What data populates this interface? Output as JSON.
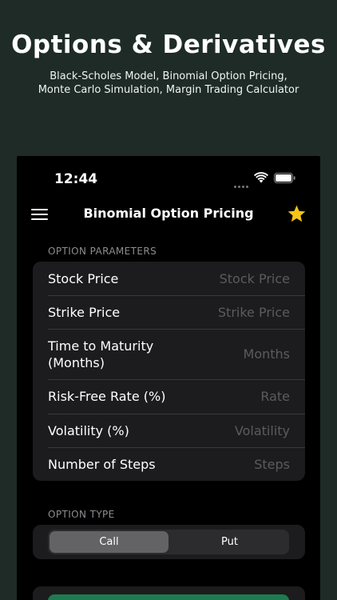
{
  "promo": {
    "title": "Options & Derivatives",
    "subtitle": "Black-Scholes Model, Binomial Option Pricing, Monte Carlo Simulation, Margin Trading Calculator"
  },
  "status_bar": {
    "time": "12:44",
    "icons": [
      "signal-dots-icon",
      "wifi-icon",
      "battery-icon"
    ]
  },
  "navbar": {
    "title": "Binomial Option Pricing",
    "left_icon": "hamburger-menu-icon",
    "right_icon": "star-icon",
    "star_color": "#f5c518"
  },
  "option_parameters": {
    "header": "OPTION PARAMETERS",
    "fields": [
      {
        "label": "Stock Price",
        "placeholder": "Stock Price",
        "value": ""
      },
      {
        "label": "Strike Price",
        "placeholder": "Strike Price",
        "value": ""
      },
      {
        "label": "Time to Maturity (Months)",
        "placeholder": "Months",
        "value": ""
      },
      {
        "label": "Risk-Free Rate (%)",
        "placeholder": "Rate",
        "value": ""
      },
      {
        "label": "Volatility (%)",
        "placeholder": "Volatility",
        "value": ""
      },
      {
        "label": "Number of Steps",
        "placeholder": "Steps",
        "value": ""
      }
    ]
  },
  "option_type": {
    "header": "OPTION TYPE",
    "options": [
      "Call",
      "Put"
    ],
    "selected": "Call"
  },
  "colors": {
    "background": "#1e2b27",
    "card": "#1c1c1e",
    "accent_green": "#1f7a4f"
  }
}
